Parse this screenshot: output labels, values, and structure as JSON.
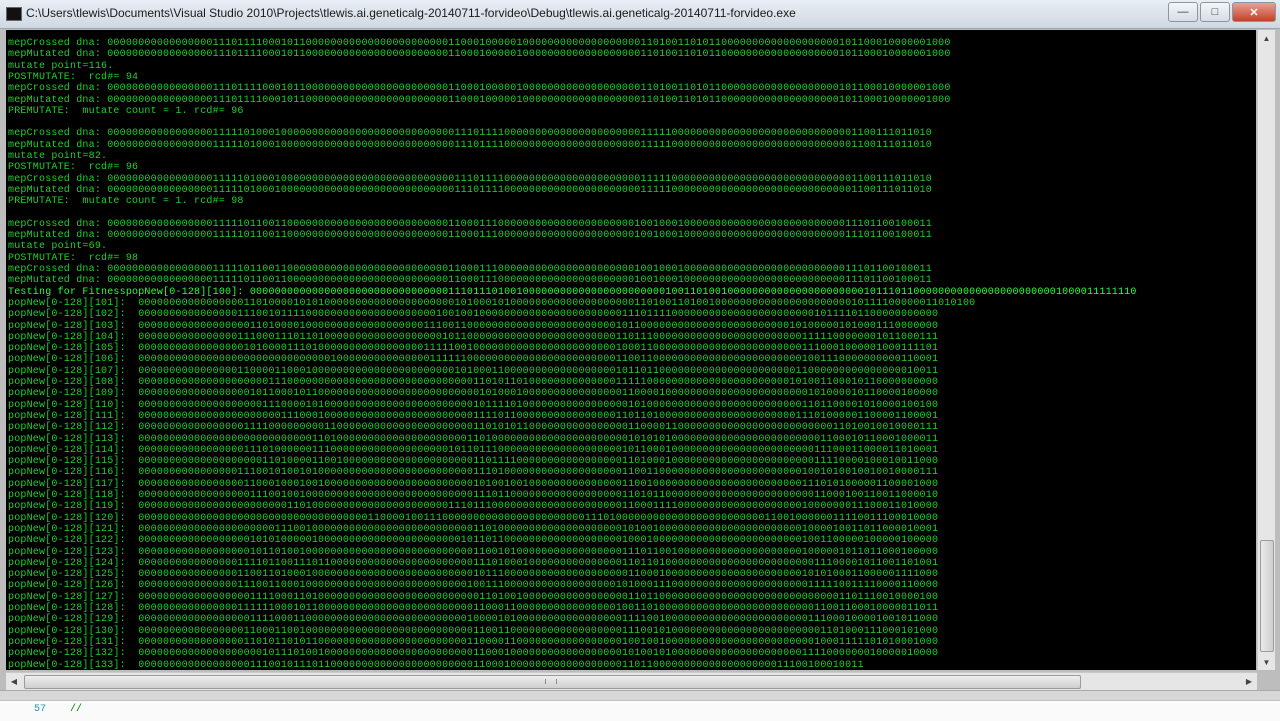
{
  "window": {
    "title": "C:\\Users\\tlewis\\Documents\\Visual Studio 2010\\Projects\\tlewis.ai.geneticalg-20140711-forvideo\\Debug\\tlewis.ai.geneticalg-20140711-forvideo.exe",
    "minimize_glyph": "—",
    "maximize_glyph": "□",
    "close_glyph": "✕"
  },
  "console": {
    "lines": [
      {
        "text": "mepCrossed dna: 0000000000000000011101111000101100000000000000000000000110001000001000000000000000000011010011010110000000000000000000101100010000001000",
        "hl": false
      },
      {
        "text": "mepMutated dna: 0000000000000000011101111000101100000000000000000000000110001000001000000000000000000011010011010110000000000000000000101100010000001000",
        "hl": false
      },
      {
        "text": "mutate point=116.",
        "hl": false
      },
      {
        "text": "POSTMUTATE:  rcd#= 94",
        "hl": false
      },
      {
        "text": "mepCrossed dna: 0000000000000000011101111000101100000000000000000000000110001000001000000000000000000011010011010110000000000000000000101100010000001000",
        "hl": false
      },
      {
        "text": "mepMutated dna: 0000000000000000011101111000101100000000000000000000000110001000001000000000000000000011010011010110000000000000000000101100010000001000",
        "hl": false
      },
      {
        "text": "PREMUTATE:  mutate count = 1. rcd#= 96",
        "hl": false
      },
      {
        "text": "",
        "hl": false
      },
      {
        "text": "mepCrossed dna: 0000000000000000011111010001000000000000000000000000000011101111000000000000000000000011111000000000000000000000000000001100111011010",
        "hl": false
      },
      {
        "text": "mepMutated dna: 0000000000000000011111010001000000000000000000000000000011101111000000000000000000000011111000000000000000000000000000001100111011010",
        "hl": false
      },
      {
        "text": "mutate point=82.",
        "hl": false
      },
      {
        "text": "POSTMUTATE:  rcd#= 96",
        "hl": false
      },
      {
        "text": "mepCrossed dna: 0000000000000000011111010001000000000000000000000000000011101111000000000000000000000011111000000000000000000000000000001100111011010",
        "hl": false
      },
      {
        "text": "mepMutated dna: 0000000000000000011111010001000000000000000000000000000011101111000000000000000000000011111000000000000000000000000000001100111011010",
        "hl": false
      },
      {
        "text": "PREMUTATE:  mutate count = 1. rcd#= 98",
        "hl": false
      },
      {
        "text": "",
        "hl": false
      },
      {
        "text": "mepCrossed dna: 0000000000000000011111011001100000000000000000000000000110001110000000000000000000000100100010000000000000000000000000011101100100011",
        "hl": false
      },
      {
        "text": "mepMutated dna: 0000000000000000011111011001100000000000000000000000000110001110000000000000000000000100100010000000000000000000000000011101100100011",
        "hl": false
      },
      {
        "text": "mutate point=69.",
        "hl": false
      },
      {
        "text": "POSTMUTATE:  rcd#= 98",
        "hl": false
      },
      {
        "text": "mepCrossed dna: 0000000000000000011111011001100000000000000000000000000110001110000000000000000000000100100010000000000000000000000000011101100100011",
        "hl": false
      },
      {
        "text": "mepMutated dna: 0000000000000000011111011001100000000000000000000000000110001110000000000000000000000100100010000000000000000000000000011101100100011",
        "hl": false
      },
      {
        "text": "Testing for FitnesspopNew[0-128][100]: 00000000000000000000000000000000111011101001000000000000000000000001001101001000000000000000000000010111011000000000000000000000001000011111110",
        "hl": true
      },
      {
        "text": "popNew[0-128][101]:  000000000000000001101000010101000000000000000000000101000101000000000000000000001101001101001000000000000000000000010111100000011010100",
        "hl": false
      },
      {
        "text": "popNew[0-128][102]:  000000000000000011100101111000000000000000000000100100100000000000000000000000111011110000000000000000000000010111101100000000000",
        "hl": false
      },
      {
        "text": "popNew[0-128][103]:  000000000000000000110100001000000000000000000011100110000000000000000000000001011000000000000000000000000101000001010001110000000",
        "hl": false
      },
      {
        "text": "popNew[0-128][104]:  000000000000000011100011101101000000000000000000010110000000000000000000000001101110000000000000000000000001111100000001011000111",
        "hl": false
      },
      {
        "text": "popNew[0-128][105]:  000000000000000001010000111010000000000000000011111001000000000000000000000001000110000000000000000000000001110001000001000111101",
        "hl": false
      },
      {
        "text": "popNew[0-128][106]:  000000000000000000000000000000010000000000000001111110000000000000000000000001100110000000000000000000000001001110000000000110001",
        "hl": false
      },
      {
        "text": "popNew[0-128][107]:  000000000000000011000011000100000000000000000000000101000110000000000000000001011011000000000000000000000011000000000000000010011",
        "hl": false
      },
      {
        "text": "popNew[0-128][108]:  000000000000000000000111000000000000000000000000000000110101101000000000000001111100000000000000000000000101001100010110000000000",
        "hl": false
      },
      {
        "text": "popNew[0-128][109]:  000000000000000000101100010110000000000000000000000000010100010000000000000000110000100000000000000000000000101000010110000100000",
        "hl": false
      },
      {
        "text": "popNew[0-128][110]:  000000000000000000001110000101000000000000000000000000101111010000000000000000010100000000000000000000000001101100001010000100100",
        "hl": false
      },
      {
        "text": "popNew[0-128][111]:  000000000000000000000001110001000000000000000000000000111101100000000000000001101101000000000000000000000011101000001100001100001",
        "hl": false
      },
      {
        "text": "popNew[0-128][112]:  000000000000000001111000000000110000000000000000000000110101011000000000000000011000011000000000000000000000000011010010010000111",
        "hl": false
      },
      {
        "text": "popNew[0-128][113]:  000000000000000000000000000011010000000000000000000001101000000000000000000000010101010000000000000000000000001100010110001000011",
        "hl": false
      },
      {
        "text": "popNew[0-128][114]:  000000000000000001110100000011100000000000000000001011011100000000000000000000101100010000000000000000000000011100011000011010001",
        "hl": false
      },
      {
        "text": "popNew[0-128][115]:  000000000000000000001101000011001000000000000000000000110111100000000000000000110100010000000000000000000000011110000100010011000",
        "hl": false
      },
      {
        "text": "popNew[0-128][116]:  000000000000000011100101001010000000000000000000000000111010000000000000000000110011000000000000000000000001001010010010010000111",
        "hl": false
      },
      {
        "text": "popNew[0-128][117]:  000000000000000001100010001001000000000000000000000000101001001000000000000000110010000000000000000000000001110101000001100001000",
        "hl": false
      },
      {
        "text": "popNew[0-128][118]:  000000000000000000111001001000000000000000000000000000111011000000000000000000110101100000000000000000000000011000100110011000010",
        "hl": false
      },
      {
        "text": "popNew[0-128][119]:  000000000000000000000000110100000000000000000000001110111000000000000000000000110001111000000000000000000001000000011100011010000",
        "hl": false
      },
      {
        "text": "popNew[0-128][120]:  000000000000000000000000000000000000011000010011100000000000000000000000111010000000000000000000000001100100000011110011100010000",
        "hl": false
      },
      {
        "text": "popNew[0-128][121]:  000000000000000000000011100100000000000000000000000000110100000000000000000000101001000000000000000000000001000010011011000010001",
        "hl": false
      },
      {
        "text": "popNew[0-128][122]:  000000000000000000101010000010000000000000000000000010110110000000000000000000100010000000000000000000000001001100000100000100000",
        "hl": false
      },
      {
        "text": "popNew[0-128][123]:  000000000000000000101101001000000000000000000000000000110010100000000000000000111011001000000000000000000001000001011011000100000",
        "hl": false
      },
      {
        "text": "popNew[0-128][124]:  000000000000000011110110011101100000000000000000000000111010001000000000000000110110100000000000000000000000011100001011001101001",
        "hl": false
      },
      {
        "text": "popNew[0-128][125]:  000000000000000011001101000100000000000000000000000000101110000000000000000000011000100000000000000000000001010100011000001111000",
        "hl": false
      },
      {
        "text": "popNew[0-128][126]:  000000000000000011100110001000000000000000000000000001001110000000000000000001010001110000000000000000000000111110011110000110000",
        "hl": false
      },
      {
        "text": "popNew[0-128][127]:  000000000000000000111100011010000000000000000000000000011010010000000000000000011011000000000000000000000000000001101110010000100",
        "hl": false
      },
      {
        "text": "popNew[0-128][128]:  000000000000000011111100010110000000000000000000000000110001100000000000000001001101000000000000000000000000011001100010000011011",
        "hl": false
      },
      {
        "text": "popNew[0-128][129]:  000000000000000000111100011000000000000000000000000001000010100000000000000000111100100000000000000000000000111000100001001011000",
        "hl": false
      },
      {
        "text": "popNew[0-128][130]:  000000000000000001100011001000000000000000000000000000110011000000000000000000111001010000000000000000000000001101000111000101000",
        "hl": false
      },
      {
        "text": "popNew[0-128][131]:  000000000000000001101011010110000000000000000000000001100001100000000000000000100100100000000000000000000000010001111101010001000",
        "hl": false
      },
      {
        "text": "popNew[0-128][132]:  000000000000000000001011101001000000000000000000000000110001000000000000000000101001010000000000000000000001111000000010000010000",
        "hl": false
      },
      {
        "text": "popNew[0-128][133]:  000000000000000000111001011101100000000000000000000000110001000000000000000000110110000000000000000000011100100010011",
        "hl": false
      }
    ]
  },
  "scrollbars": {
    "up_glyph": "▲",
    "down_glyph": "▼",
    "left_glyph": "◀",
    "right_glyph": "▶"
  },
  "editor": {
    "line_number": "57",
    "code": "//"
  }
}
